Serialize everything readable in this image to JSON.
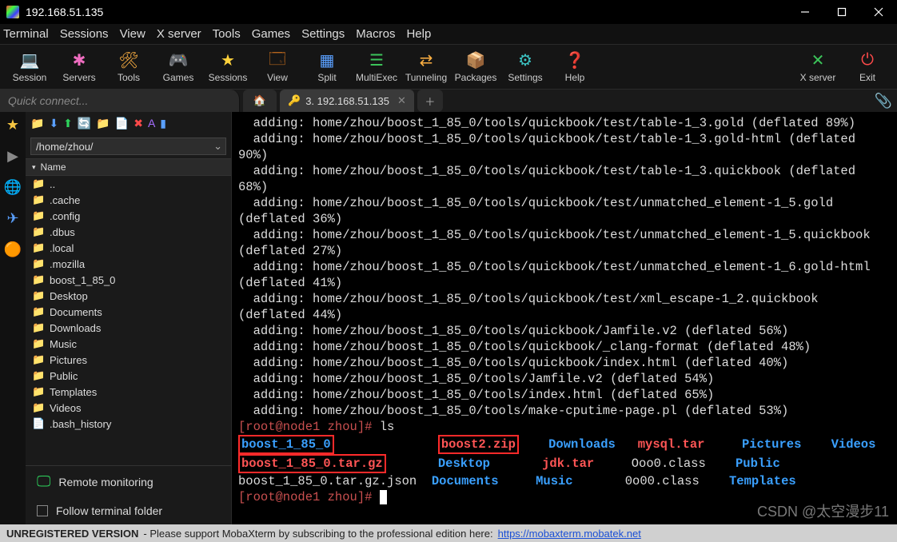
{
  "window": {
    "title": "192.168.51.135"
  },
  "menu": [
    "Terminal",
    "Sessions",
    "View",
    "X server",
    "Tools",
    "Games",
    "Settings",
    "Macros",
    "Help"
  ],
  "toolbar": [
    {
      "label": "Session",
      "icon": "💻",
      "color": "#3aa0ff"
    },
    {
      "label": "Servers",
      "icon": "✱",
      "color": "#ef6dc0"
    },
    {
      "label": "Tools",
      "icon": "🛠",
      "color": "#ffb142"
    },
    {
      "label": "Games",
      "icon": "🎮",
      "color": "#d6d6d6"
    },
    {
      "label": "Sessions",
      "icon": "★",
      "color": "#ffd23c"
    },
    {
      "label": "View",
      "icon": "🗔",
      "color": "#b5651d"
    },
    {
      "label": "Split",
      "icon": "▦",
      "color": "#5aa0ff"
    },
    {
      "label": "MultiExec",
      "icon": "☰",
      "color": "#3cc45a"
    },
    {
      "label": "Tunneling",
      "icon": "⇄",
      "color": "#ffb142"
    },
    {
      "label": "Packages",
      "icon": "📦",
      "color": "#5aa0ff"
    },
    {
      "label": "Settings",
      "icon": "⚙",
      "color": "#3cc4c4"
    },
    {
      "label": "Help",
      "icon": "❓",
      "color": "#2a8cff"
    }
  ],
  "toolbar_right": [
    {
      "label": "X server",
      "icon": "✕",
      "color": "#3cc45a"
    },
    {
      "label": "Exit",
      "icon": "⏻",
      "color": "#ff4a4a"
    }
  ],
  "quick_connect_placeholder": "Quick connect...",
  "tabs": {
    "active_label": "3. 192.168.51.135"
  },
  "side_icons": [
    "★",
    "▶",
    "🌐",
    "✈",
    "🟠"
  ],
  "fileops": [
    {
      "g": "📁",
      "c": "#f5c542",
      "n": "folder-icon"
    },
    {
      "g": "⬇",
      "c": "#5aa0ff",
      "n": "download-icon"
    },
    {
      "g": "⬆",
      "c": "#2dd45c",
      "n": "upload-icon"
    },
    {
      "g": "🔄",
      "c": "#2dd45c",
      "n": "refresh-icon"
    },
    {
      "g": "📁",
      "c": "#2dd45c",
      "n": "newfolder-icon"
    },
    {
      "g": "📄",
      "c": "#5aa0ff",
      "n": "newfile-icon"
    },
    {
      "g": "✖",
      "c": "#ff4a4a",
      "n": "delete-icon"
    },
    {
      "g": "A",
      "c": "#a56dff",
      "n": "properties-icon"
    },
    {
      "g": "▮",
      "c": "#5aa0ff",
      "n": "toggle-icon"
    }
  ],
  "path": "/home/zhou/",
  "name_header": "Name",
  "files": [
    {
      "name": "..",
      "cls": "folder-g"
    },
    {
      "name": ".cache",
      "cls": "folder-y"
    },
    {
      "name": ".config",
      "cls": "folder-y"
    },
    {
      "name": ".dbus",
      "cls": "folder-y"
    },
    {
      "name": ".local",
      "cls": "folder-y"
    },
    {
      "name": ".mozilla",
      "cls": "folder-y"
    },
    {
      "name": "boost_1_85_0",
      "cls": "folder-y"
    },
    {
      "name": "Desktop",
      "cls": "folder-y"
    },
    {
      "name": "Documents",
      "cls": "folder-y"
    },
    {
      "name": "Downloads",
      "cls": "folder-y"
    },
    {
      "name": "Music",
      "cls": "folder-y"
    },
    {
      "name": "Pictures",
      "cls": "folder-y"
    },
    {
      "name": "Public",
      "cls": "folder-y"
    },
    {
      "name": "Templates",
      "cls": "folder-y"
    },
    {
      "name": "Videos",
      "cls": "folder-y"
    },
    {
      "name": ".bash_history",
      "cls": "folder-g"
    }
  ],
  "remote_monitoring": "Remote monitoring",
  "follow_terminal": "Follow terminal folder",
  "terminal_lines": [
    {
      "t": "  adding: home/zhou/boost_1_85_0/tools/quickbook/test/table-1_3.gold (deflated 89%)"
    },
    {
      "t": "  adding: home/zhou/boost_1_85_0/tools/quickbook/test/table-1_3.gold-html (deflated 90%)"
    },
    {
      "t": "  adding: home/zhou/boost_1_85_0/tools/quickbook/test/table-1_3.quickbook (deflated 68%)"
    },
    {
      "t": "  adding: home/zhou/boost_1_85_0/tools/quickbook/test/unmatched_element-1_5.gold (deflated 36%)"
    },
    {
      "t": "  adding: home/zhou/boost_1_85_0/tools/quickbook/test/unmatched_element-1_5.quickbook (deflated 27%)"
    },
    {
      "t": "  adding: home/zhou/boost_1_85_0/tools/quickbook/test/unmatched_element-1_6.gold-html (deflated 41%)"
    },
    {
      "t": "  adding: home/zhou/boost_1_85_0/tools/quickbook/test/xml_escape-1_2.quickbook (deflated 44%)"
    },
    {
      "t": "  adding: home/zhou/boost_1_85_0/tools/quickbook/Jamfile.v2 (deflated 56%)"
    },
    {
      "t": "  adding: home/zhou/boost_1_85_0/tools/quickbook/_clang-format (deflated 48%)"
    },
    {
      "t": "  adding: home/zhou/boost_1_85_0/tools/quickbook/index.html (deflated 40%)"
    },
    {
      "t": "  adding: home/zhou/boost_1_85_0/tools/Jamfile.v2 (deflated 54%)"
    },
    {
      "t": "  adding: home/zhou/boost_1_85_0/tools/index.html (deflated 65%)"
    },
    {
      "t": "  adding: home/zhou/boost_1_85_0/tools/make-cputime-page.pl (deflated 53%)"
    }
  ],
  "prompt1": "[root@node1 zhou]# ",
  "cmd1": "ls",
  "ls_row1": [
    {
      "txt": "boost_1_85_0",
      "cls": "tdir",
      "box": 1
    },
    {
      "txt": "boost2.zip",
      "cls": "tarch",
      "box": 1
    },
    {
      "txt": "Downloads",
      "cls": "tdir"
    },
    {
      "txt": "mysql.tar",
      "cls": "tarch"
    },
    {
      "txt": "Pictures",
      "cls": "tdir"
    },
    {
      "txt": "Videos",
      "cls": "tdir"
    }
  ],
  "ls_row2": [
    {
      "txt": "boost_1_85_0.tar.gz",
      "cls": "tarch",
      "box": 1
    },
    {
      "txt": "Desktop",
      "cls": "tdir"
    },
    {
      "txt": "jdk.tar",
      "cls": "tarch"
    },
    {
      "txt": "Ooo0.class",
      "cls": ""
    },
    {
      "txt": "Public",
      "cls": "tdir"
    }
  ],
  "ls_row3": [
    {
      "txt": "boost_1_85_0.tar.gz.json",
      "cls": ""
    },
    {
      "txt": "Documents",
      "cls": "tdir"
    },
    {
      "txt": "Music",
      "cls": "tdir"
    },
    {
      "txt": "0o00.class",
      "cls": ""
    },
    {
      "txt": "Templates",
      "cls": "tdir"
    }
  ],
  "prompt2": "[root@node1 zhou]# ",
  "status": {
    "unreg": "UNREGISTERED VERSION",
    "msg": "  -  Please support MobaXterm by subscribing to the professional edition here:  ",
    "url": "https://mobaxterm.mobatek.net"
  },
  "watermark": "CSDN @太空漫步11"
}
